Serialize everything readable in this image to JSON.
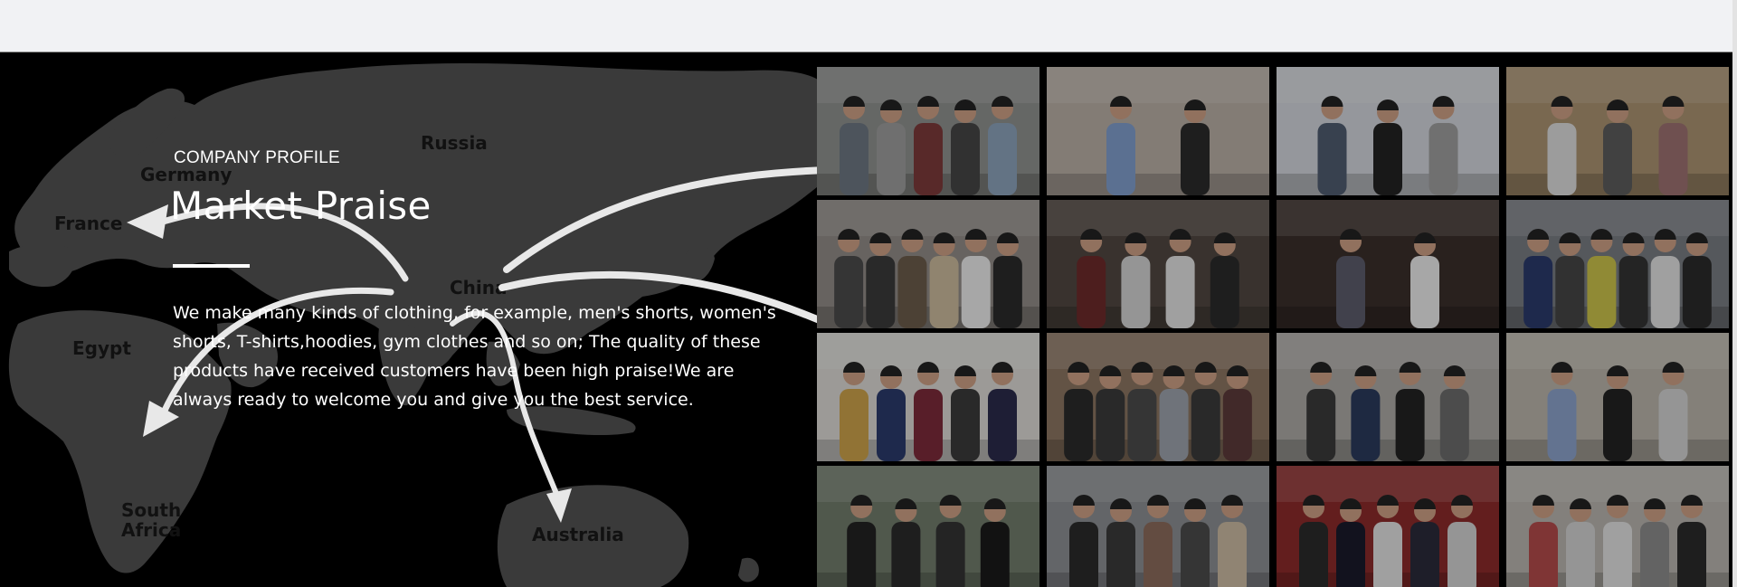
{
  "section": {
    "eyebrow": "COMPANY PROFILE",
    "title": "Market Praise",
    "description": "We make many kinds of clothing, for example, men's shorts, women's shorts, T-shirts,hoodies, gym clothes and so on; The quality of these products have received customers have been high praise!We are always ready to welcome you and give you the best service."
  },
  "map": {
    "countries": [
      "Russia",
      "Germany",
      "France",
      "China",
      "Egypt",
      "South",
      "Africa",
      "Australia"
    ]
  },
  "colors": {
    "background": "#000000",
    "land": "#3a3a3a",
    "arrows": "#e8e8e8",
    "text": "#ffffff",
    "topbar": "#f1f2f4"
  },
  "photos": [
    {
      "scene": "factory floor group",
      "bg": "#8d8f8c",
      "people": [
        "#6b7580",
        "#9a9a9a",
        "#7a3a3a",
        "#444",
        "#8aa0b8"
      ]
    },
    {
      "scene": "showroom duo",
      "bg": "#b6aca3",
      "people": [
        "#7f9cc9",
        "#2a2a2a"
      ]
    },
    {
      "scene": "trade fair trio",
      "bg": "#cfd2d8",
      "people": [
        "#4e5a6e",
        "#222",
        "#9c9c9c"
      ]
    },
    {
      "scene": "gallery trio",
      "bg": "#a8906f",
      "people": [
        "#d8d8d8",
        "#5a5a5a",
        "#9a7070"
      ]
    },
    {
      "scene": "outdoor group",
      "bg": "#8f8a86",
      "people": [
        "#4a4a4a",
        "#3a3a3a",
        "#6a5a4a",
        "#c8b89a",
        "#e8e8e8",
        "#2a2a2a"
      ]
    },
    {
      "scene": "office group",
      "bg": "#4f4640",
      "people": [
        "#6b2a2a",
        "#cfcfcf",
        "#dedede",
        "#2a2a2a"
      ]
    },
    {
      "scene": "handshake",
      "bg": "#3a2e2a",
      "people": [
        "#5a5a6a",
        "#e8e8e8"
      ]
    },
    {
      "scene": "celebration group",
      "bg": "#777a80",
      "people": [
        "#2a3a6a",
        "#444",
        "#c8c04a",
        "#333",
        "#dedede",
        "#2a2a2a"
      ]
    },
    {
      "scene": "lobby group",
      "bg": "#d8d6d2",
      "people": [
        "#c9a04a",
        "#2a3a6a",
        "#7a2a3a",
        "#3a3a3a",
        "#2a2a4a"
      ]
    },
    {
      "scene": "certificate wall",
      "bg": "#8a7460",
      "people": [
        "#2a2a2a",
        "#3a3a3a",
        "#4a4a4a",
        "#9aa0aa",
        "#3a3a3a",
        "#5a3a3a"
      ]
    },
    {
      "scene": "meeting room",
      "bg": "#a9a7a2",
      "people": [
        "#3a3a3a",
        "#2a3a5a",
        "#222",
        "#6a6a6a"
      ]
    },
    {
      "scene": "display room",
      "bg": "#b8b2a8",
      "people": [
        "#8aa0c8",
        "#222",
        "#cfcfcf"
      ]
    },
    {
      "scene": "car park group",
      "bg": "#6f7a6a",
      "people": [
        "#222",
        "#2a2a2a",
        "#333",
        "#1a1a1a"
      ]
    },
    {
      "scene": "expo group",
      "bg": "#8a8c90",
      "people": [
        "#2a2a2a",
        "#3a3a3a",
        "#8a6a5a",
        "#4a4a4a",
        "#c8b8a0"
      ]
    },
    {
      "scene": "red booth",
      "bg": "#8a2a2a",
      "people": [
        "#2a2a2a",
        "#1a1a2a",
        "#dedede",
        "#2a2a3a",
        "#cfcfcf"
      ]
    },
    {
      "scene": "warehouse group",
      "bg": "#b6b2ac",
      "people": [
        "#b04a4a",
        "#cfcfcf",
        "#dedede",
        "#8a8a8a",
        "#2a2a2a"
      ]
    }
  ]
}
